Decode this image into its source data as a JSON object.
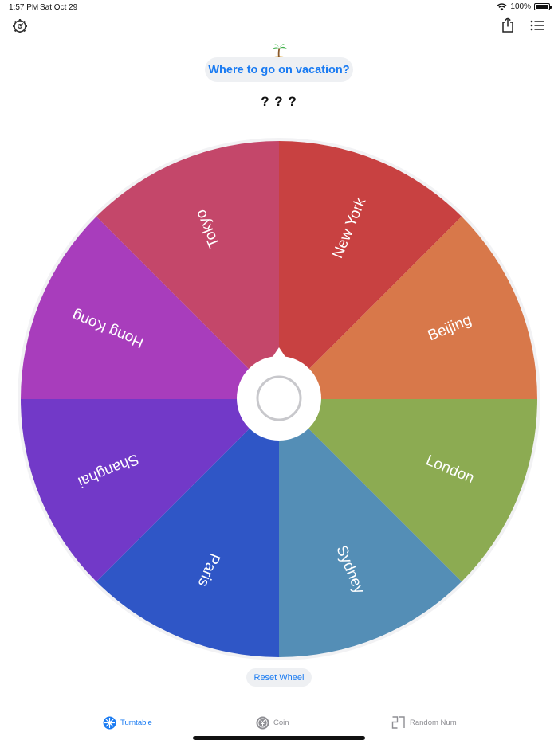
{
  "status_bar": {
    "time": "1:57 PM",
    "date": "Sat Oct 29",
    "battery": "100%",
    "battery_level": 1.0
  },
  "toolbar": {
    "settings_icon": "gear-icon",
    "share_icon": "share-icon",
    "list_icon": "list-icon"
  },
  "title": {
    "emoji": "desert-island-icon",
    "text": "Where to go on vacation?"
  },
  "result": "? ? ?",
  "wheel": {
    "segments": [
      {
        "label": "New York",
        "color": "#c84141"
      },
      {
        "label": "Beijing",
        "color": "#d8784a"
      },
      {
        "label": "London",
        "color": "#8cab52"
      },
      {
        "label": "Sydney",
        "color": "#548eb6"
      },
      {
        "label": "Paris",
        "color": "#2f56c6"
      },
      {
        "label": "Shanghai",
        "color": "#7239c8"
      },
      {
        "label": "Hong Kong",
        "color": "#a83dbc"
      },
      {
        "label": "Tokyo",
        "color": "#c4476a"
      }
    ]
  },
  "reset_label": "Reset Wheel",
  "tabs": [
    {
      "label": "Turntable",
      "icon": "turntable-icon",
      "active": true
    },
    {
      "label": "Coin",
      "icon": "coin-icon",
      "active": false
    },
    {
      "label": "Random Num",
      "icon": "random-number-icon",
      "active": false
    }
  ],
  "colors": {
    "accent": "#1a7bf2",
    "inactive": "#8e8e93",
    "pill_bg": "#eef0f3"
  }
}
